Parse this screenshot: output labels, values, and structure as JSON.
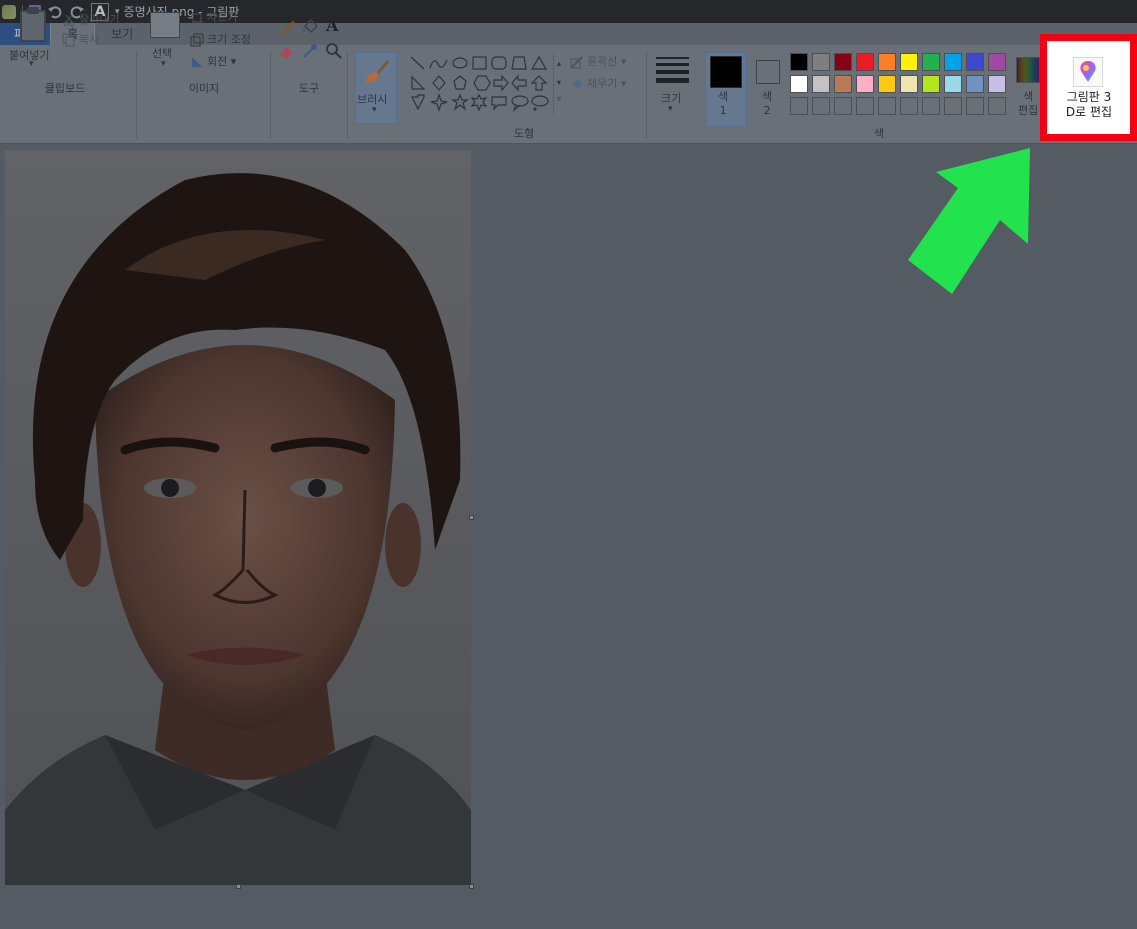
{
  "window": {
    "title": "증명사진.png - 그림판"
  },
  "tabs": [
    {
      "label": "파일"
    },
    {
      "label": "홈"
    },
    {
      "label": "보기"
    }
  ],
  "clipboard": {
    "paste": "붙여넣기",
    "cut": "잘라내기",
    "copy": "복사",
    "group_label": "클립보드"
  },
  "image": {
    "select": "선택",
    "crop": "자르기",
    "resize": "크기 조정",
    "rotate": "회전",
    "group_label": "이미지"
  },
  "tools": {
    "group_label": "도구"
  },
  "brushes": {
    "label": "브러시"
  },
  "shapes": {
    "outline": "윤곽선",
    "fill": "채우기",
    "group_label": "도형"
  },
  "size": {
    "label": "크기"
  },
  "colors": {
    "color1_label": "색\n1",
    "color1_value": "#000000",
    "color2_label": "색\n2",
    "edit_colors": "색\n편집",
    "group_label": "색",
    "palette": [
      "#000000",
      "#7f7f7f",
      "#880015",
      "#ed1c24",
      "#ff7f27",
      "#fff200",
      "#22b14c",
      "#00a2e8",
      "#3f48cc",
      "#a349a4",
      "#ffffff",
      "#c3c3c3",
      "#b97a57",
      "#ffaec9",
      "#ffc90e",
      "#efe4b0",
      "#b5e61d",
      "#99d9ea",
      "#7092be",
      "#c8bfe7"
    ]
  },
  "paint3d": {
    "label_line1": "그림판 3",
    "label_line2": "D로 편집"
  },
  "annotation": {
    "highlight_color": "#f50010",
    "arrow_color": "#22e34e"
  }
}
